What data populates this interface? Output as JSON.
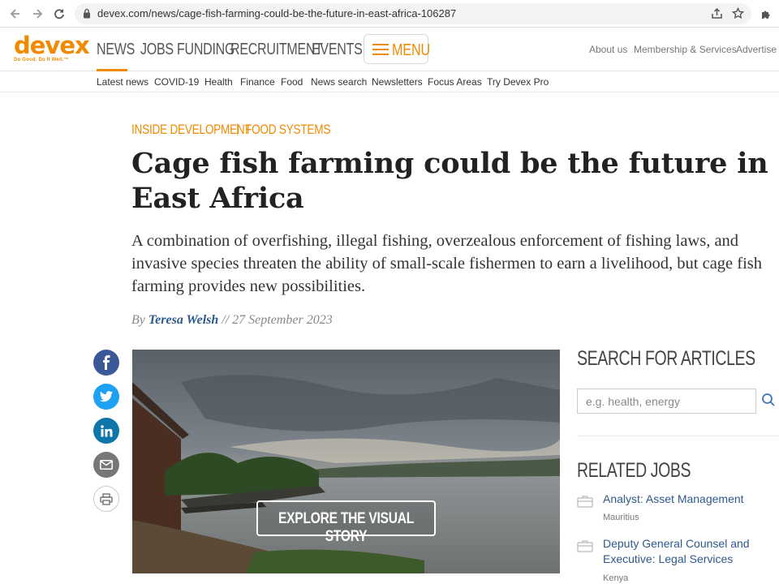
{
  "browser": {
    "url": "devex.com/news/cage-fish-farming-could-be-the-future-in-east-africa-106287"
  },
  "header": {
    "logo_text": "devex",
    "logo_tagline": "Do Good. Do It Well.™",
    "nav": [
      "NEWS",
      "JOBS",
      "FUNDING",
      "RECRUITMENT",
      "EVENTS"
    ],
    "menu_label": "MENU",
    "utility_links": [
      "About us",
      "Membership & Services",
      "Advertise"
    ]
  },
  "sub_nav": [
    "Latest news",
    "COVID-19",
    "Health",
    "Finance",
    "Food",
    "News search",
    "Newsletters",
    "Focus Areas",
    "Try Devex Pro"
  ],
  "article": {
    "kicker_primary": "INSIDE DEVELOPMENT",
    "kicker_secondary": "FOOD SYSTEMS",
    "title": "Cage fish farming could be the future in East Africa",
    "dek": "A combination of overfishing, illegal fishing, overzealous enforcement of fishing laws, and invasive species threaten the ability of small-scale fishermen to earn a livelihood, but cage fish farming provides new possibilities.",
    "byline_prefix": "By",
    "author": "Teresa Welsh",
    "date_sep": "//",
    "date": "27 September 2023",
    "hero_button": "EXPLORE THE VISUAL STORY"
  },
  "social": [
    "facebook-icon",
    "twitter-icon",
    "linkedin-icon",
    "email-icon",
    "print-icon"
  ],
  "sidebar": {
    "search_heading": "SEARCH FOR ARTICLES",
    "search_placeholder": "e.g. health, energy",
    "jobs_heading": "RELATED JOBS",
    "jobs": [
      {
        "title": "Analyst: Asset Management",
        "location": "Mauritius"
      },
      {
        "title": "Deputy General Counsel and Executive: Legal Services",
        "location": "Kenya"
      }
    ]
  },
  "colors": {
    "brand_orange": "#f08a00",
    "link_blue": "#2d5a8c",
    "facebook": "#3b5998",
    "twitter": "#1da1f2",
    "linkedin": "#0e76a8",
    "email": "#777777"
  }
}
